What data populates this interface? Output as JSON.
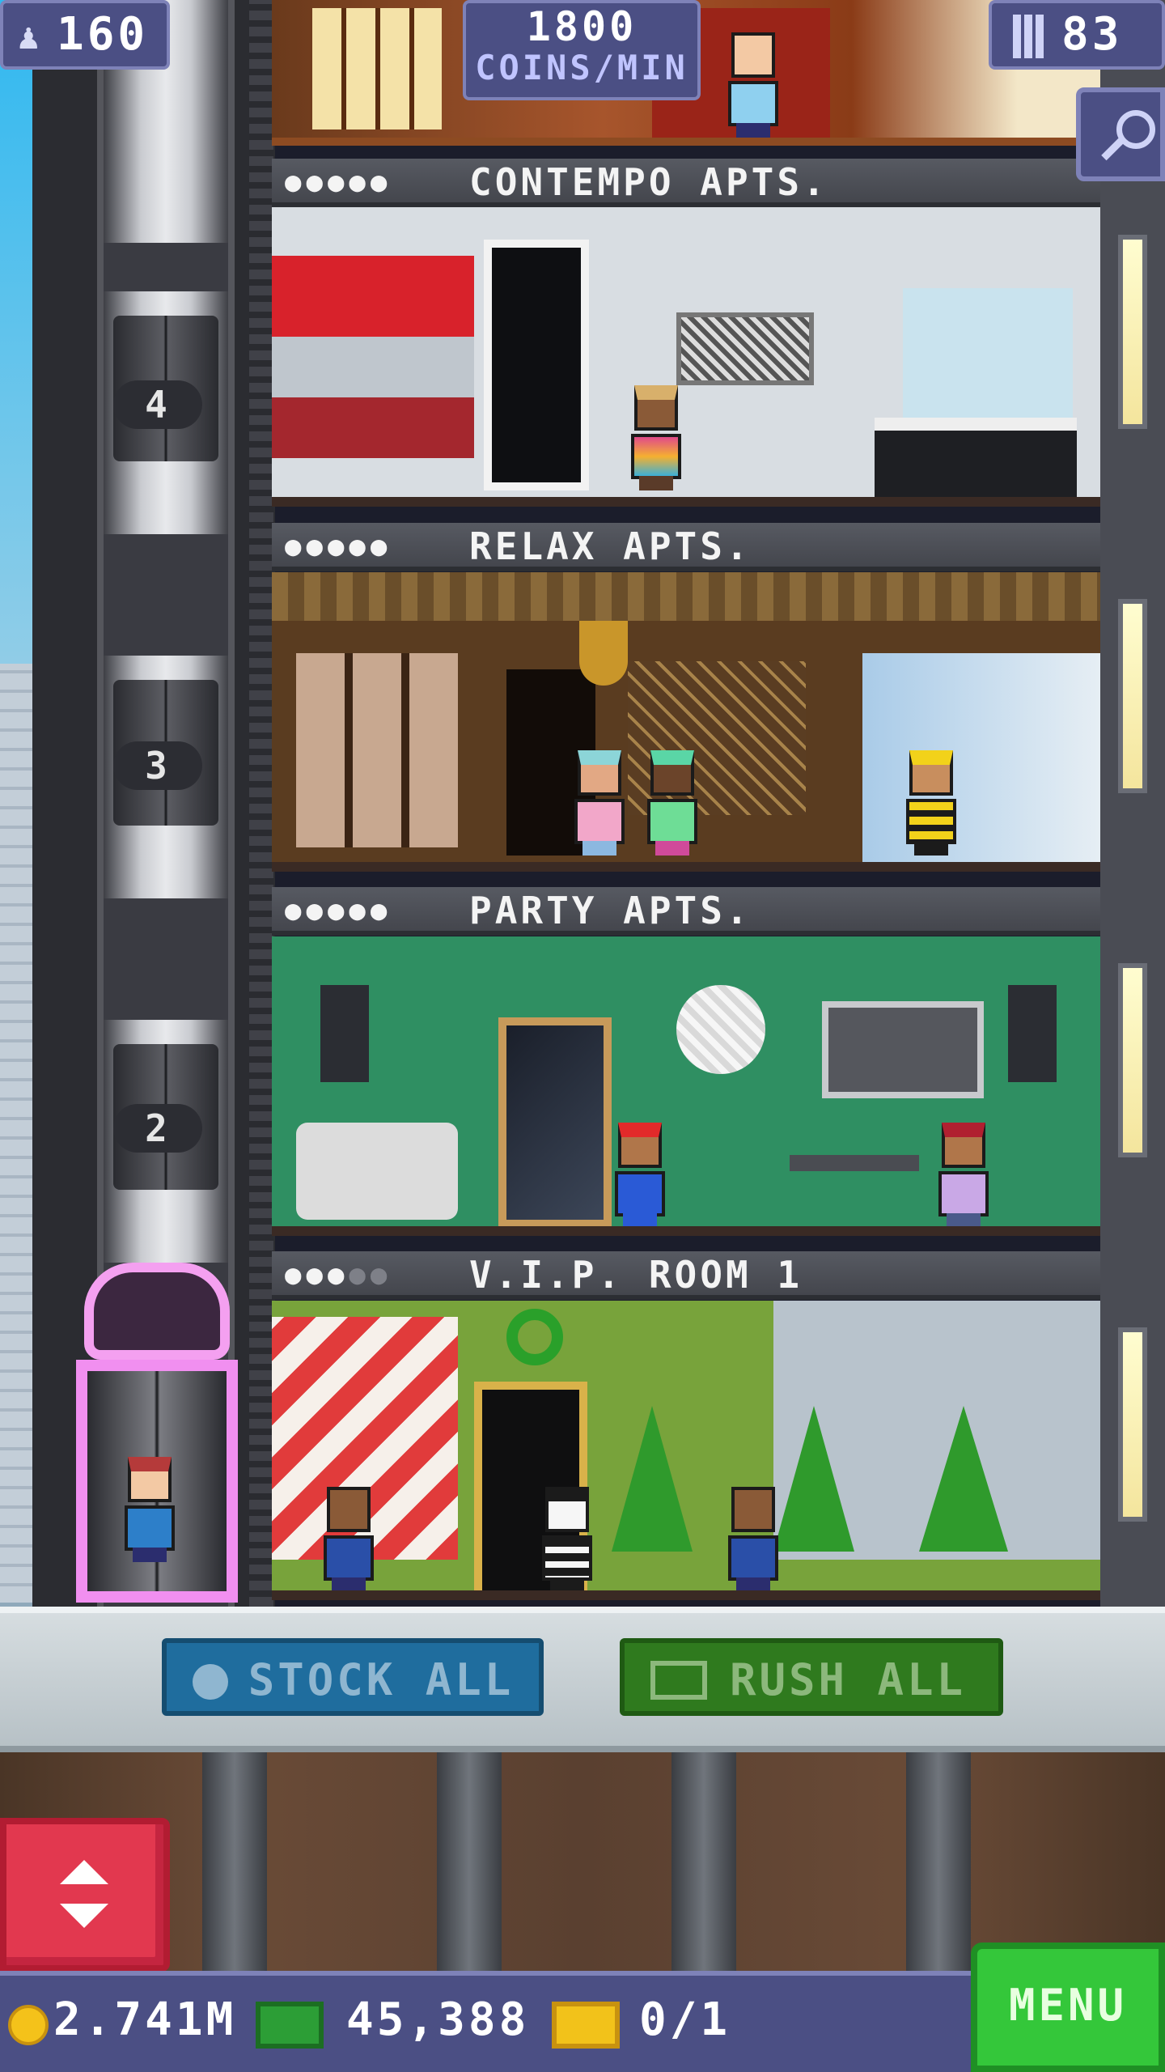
{
  "hud": {
    "population": "160",
    "income_value": "1800",
    "income_unit": "COINS/MIN",
    "floor_count": "83"
  },
  "elevator_floor_labels": [
    "4",
    "3",
    "2"
  ],
  "floors": [
    {
      "name": "CONTEMPO APTS.",
      "stars_filled": "●●●●●",
      "stars_empty": ""
    },
    {
      "name": "RELAX APTS.",
      "stars_filled": "●●●●●",
      "stars_empty": ""
    },
    {
      "name": "PARTY APTS.",
      "stars_filled": "●●●●●",
      "stars_empty": ""
    },
    {
      "name": "V.I.P. ROOM 1",
      "stars_filled": "●●●",
      "stars_empty": "●●"
    }
  ],
  "actions": {
    "stock_all": "STOCK ALL",
    "rush_all": "RUSH ALL"
  },
  "status": {
    "coins": "2.741M",
    "bux": "45,388",
    "tickets": "0/1"
  },
  "menu_label": "MENU",
  "icons": {
    "population": "person-icon",
    "floors": "building-icon",
    "search": "magnifier-icon",
    "stock": "clock-icon",
    "rush": "cash-icon",
    "coin": "coin-icon",
    "bux": "tower-bux-icon",
    "ticket": "golden-ticket-icon",
    "elevator": "elevator-arrows-icon"
  },
  "colors": {
    "hud": "#4b4f84",
    "stock_button": "#1f6d9e",
    "rush_button": "#2f7a1e",
    "menu_button": "#34c73a",
    "elevator_button": "#e2384f",
    "vip_elevator": "#f18ff0"
  }
}
